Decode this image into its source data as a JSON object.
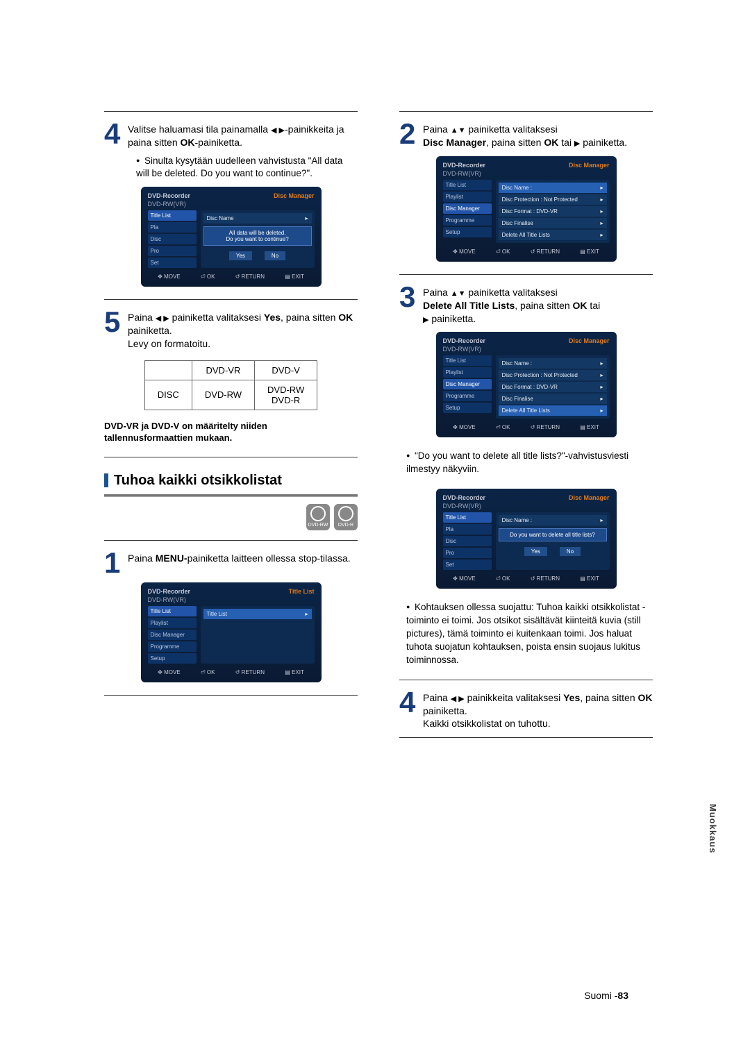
{
  "side_tab": "Muokkaus",
  "footer": {
    "lang": "Suomi -",
    "page": "83"
  },
  "left": {
    "step4": {
      "line1_a": "Valitse haluamasi tila painamalla ",
      "line1_b": "-painikkeita ja paina sitten ",
      "line1_ok": "OK",
      "line1_c": "-painiketta.",
      "bullet": "Sinulta kysytään uudelleen vahvistusta \"All data will be deleted. Do you want to continue?\"."
    },
    "panel1": {
      "tl": "DVD-Recorder",
      "tr": "Disc Manager",
      "sub": "DVD-RW(VR)",
      "side": [
        "Title List",
        "Pla",
        "Disc",
        "Pro",
        "Set"
      ],
      "main_top": "Disc Name",
      "dialog_l1": "All data will be deleted.",
      "dialog_l2": "Do you want to continue?",
      "yes": "Yes",
      "no": "No",
      "foot": [
        "MOVE",
        "OK",
        "RETURN",
        "EXIT"
      ]
    },
    "step5": {
      "line1_a": "Paina ",
      "line1_b": " painiketta valitaksesi ",
      "line1_yes": "Yes",
      "line1_c": ", paina sitten ",
      "line1_ok": "OK",
      "line1_d": " painiketta.",
      "line2": "Levy on formatoitu."
    },
    "table": {
      "r1c2": "DVD-VR",
      "r1c3": "DVD-V",
      "r2c1": "DISC",
      "r2c2": "DVD-RW",
      "r2c3a": "DVD-RW",
      "r2c3b": "DVD-R"
    },
    "note": "DVD-VR ja DVD-V on määritelty niiden tallennusformaattien mukaan.",
    "section_title": "Tuhoa kaikki otsikkolistat",
    "disc_icons": [
      "DVD-RW",
      "DVD-R"
    ],
    "step1": {
      "line1_a": "Paina ",
      "line1_menu": "MENU-",
      "line1_b": "painiketta laitteen ollessa stop-tilassa."
    },
    "panel2": {
      "tl": "DVD-Recorder",
      "tr": "Title List",
      "sub": "DVD-RW(VR)",
      "side": [
        "Title List",
        "Playlist",
        "Disc Manager",
        "Programme",
        "Setup"
      ],
      "row": "Title List",
      "foot": [
        "MOVE",
        "OK",
        "RETURN",
        "EXIT"
      ]
    }
  },
  "right": {
    "step2": {
      "line1_a": "Paina ",
      "line1_b": " painiketta valitaksesi ",
      "line1_dm": "Disc Manager",
      "line1_c": ", paina sitten ",
      "line1_ok": "OK",
      "line1_d": " tai ",
      "line1_e": " painiketta."
    },
    "panel3": {
      "tl": "DVD-Recorder",
      "tr": "Disc Manager",
      "sub": "DVD-RW(VR)",
      "side": [
        "Title List",
        "Playlist",
        "Disc Manager",
        "Programme",
        "Setup"
      ],
      "rows": [
        {
          "l": "Disc Name :",
          "r": ""
        },
        {
          "l": "Disc Protection : Not Protected",
          "r": ""
        },
        {
          "l": "Disc Format       : DVD-VR",
          "r": ""
        },
        {
          "l": "Disc Finalise",
          "r": ""
        },
        {
          "l": "Delete All Title Lists",
          "r": ""
        }
      ],
      "foot": [
        "MOVE",
        "OK",
        "RETURN",
        "EXIT"
      ]
    },
    "step3": {
      "line1_a": "Paina ",
      "line1_b": " painiketta valitaksesi ",
      "line1_del": "Delete All Title Lists",
      "line1_c": ", paina sitten ",
      "line1_ok": "OK",
      "line1_d": " tai ",
      "line1_e": " painiketta."
    },
    "panel4": {
      "tl": "DVD-Recorder",
      "tr": "Disc Manager",
      "sub": "DVD-RW(VR)",
      "side": [
        "Title List",
        "Playlist",
        "Disc Manager",
        "Programme",
        "Setup"
      ],
      "rows": [
        {
          "l": "Disc Name :",
          "r": ""
        },
        {
          "l": "Disc Protection : Not Protected",
          "r": ""
        },
        {
          "l": "Disc Format       : DVD-VR",
          "r": ""
        },
        {
          "l": "Disc Finalise",
          "r": ""
        },
        {
          "l": "Delete All Title Lists",
          "r": "",
          "hl": true
        }
      ],
      "foot": [
        "MOVE",
        "OK",
        "RETURN",
        "EXIT"
      ]
    },
    "bullet1": "\"Do you want to delete all title lists?\"-vahvistusviesti ilmestyy näkyviin.",
    "panel5": {
      "tl": "DVD-Recorder",
      "tr": "Disc Manager",
      "sub": "DVD-RW(VR)",
      "side": [
        "Title List",
        "Pla",
        "Disc",
        "Pro",
        "Set"
      ],
      "main_top": "Disc Name :",
      "dialog": "Do you want to delete all title lists?",
      "yes": "Yes",
      "no": "No",
      "foot": [
        "MOVE",
        "OK",
        "RETURN",
        "EXIT"
      ]
    },
    "bullet2": "Kohtauksen ollessa suojattu: Tuhoa kaikki otsikkolistat -toiminto ei toimi. Jos otsikot sisältävät kiinteitä kuvia (still pictures), tämä toiminto ei kuitenkaan toimi. Jos haluat tuhota suojatun kohtauksen, poista ensin suojaus lukitus toiminnossa.",
    "step4": {
      "line1_a": "Paina ",
      "line1_b": " painikkeita valitaksesi ",
      "line1_yes": "Yes",
      "line1_c": ", paina sitten ",
      "line1_ok": "OK",
      "line1_d": " painiketta.",
      "line2": "Kaikki otsikkolistat on tuhottu."
    }
  }
}
